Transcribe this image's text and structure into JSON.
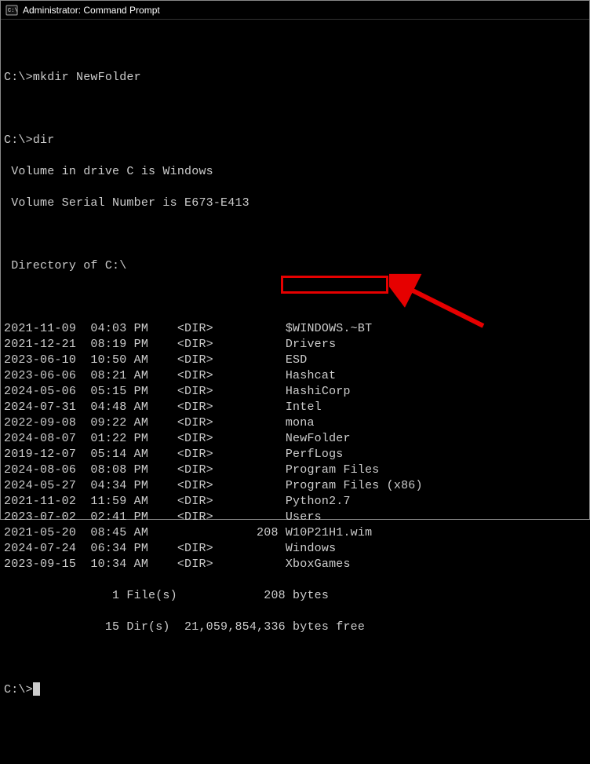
{
  "window": {
    "title": "Administrator: Command Prompt"
  },
  "prompt1": "C:\\>",
  "cmd1": "mkdir NewFolder",
  "prompt2": "C:\\>",
  "cmd2": "dir",
  "vol_line": " Volume in drive C is Windows",
  "serial_line": " Volume Serial Number is E673-E413",
  "dir_of_line": " Directory of C:\\",
  "entries": [
    {
      "date": "2021-11-09",
      "time": "04:03 PM",
      "type": "<DIR>",
      "size": "",
      "name": "$WINDOWS.~BT"
    },
    {
      "date": "2021-12-21",
      "time": "08:19 PM",
      "type": "<DIR>",
      "size": "",
      "name": "Drivers"
    },
    {
      "date": "2023-06-10",
      "time": "10:50 AM",
      "type": "<DIR>",
      "size": "",
      "name": "ESD"
    },
    {
      "date": "2023-06-06",
      "time": "08:21 AM",
      "type": "<DIR>",
      "size": "",
      "name": "Hashcat"
    },
    {
      "date": "2024-05-06",
      "time": "05:15 PM",
      "type": "<DIR>",
      "size": "",
      "name": "HashiCorp"
    },
    {
      "date": "2024-07-31",
      "time": "04:48 AM",
      "type": "<DIR>",
      "size": "",
      "name": "Intel"
    },
    {
      "date": "2022-09-08",
      "time": "09:22 AM",
      "type": "<DIR>",
      "size": "",
      "name": "mona"
    },
    {
      "date": "2024-08-07",
      "time": "01:22 PM",
      "type": "<DIR>",
      "size": "",
      "name": "NewFolder"
    },
    {
      "date": "2019-12-07",
      "time": "05:14 AM",
      "type": "<DIR>",
      "size": "",
      "name": "PerfLogs"
    },
    {
      "date": "2024-08-06",
      "time": "08:08 PM",
      "type": "<DIR>",
      "size": "",
      "name": "Program Files"
    },
    {
      "date": "2024-05-27",
      "time": "04:34 PM",
      "type": "<DIR>",
      "size": "",
      "name": "Program Files (x86)"
    },
    {
      "date": "2021-11-02",
      "time": "11:59 AM",
      "type": "<DIR>",
      "size": "",
      "name": "Python2.7"
    },
    {
      "date": "2023-07-02",
      "time": "02:41 PM",
      "type": "<DIR>",
      "size": "",
      "name": "Users"
    },
    {
      "date": "2021-05-20",
      "time": "08:45 AM",
      "type": "",
      "size": "208",
      "name": "W10P21H1.wim"
    },
    {
      "date": "2024-07-24",
      "time": "06:34 PM",
      "type": "<DIR>",
      "size": "",
      "name": "Windows"
    },
    {
      "date": "2023-09-15",
      "time": "10:34 AM",
      "type": "<DIR>",
      "size": "",
      "name": "XboxGames"
    }
  ],
  "summary_files": "               1 File(s)            208 bytes",
  "summary_dirs": "              15 Dir(s)  21,059,854,336 bytes free",
  "prompt3": "C:\\>"
}
